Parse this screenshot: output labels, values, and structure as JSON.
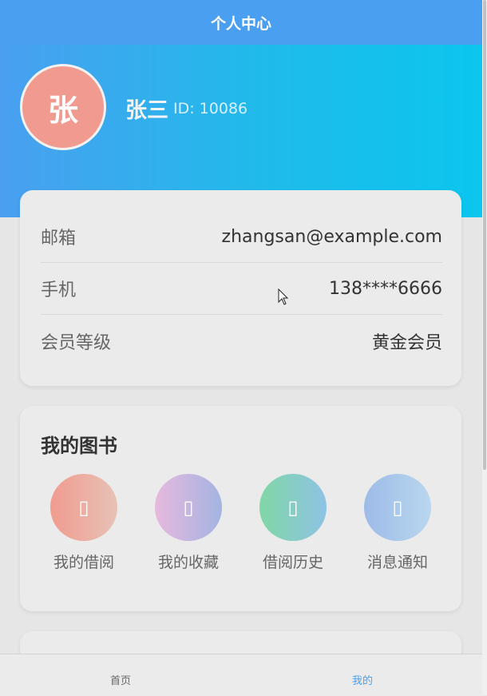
{
  "header": {
    "title": "个人中心"
  },
  "profile": {
    "avatar_char": "张",
    "name": "张三",
    "id_text": "ID: 10086"
  },
  "info": [
    {
      "label": "邮箱",
      "value": "zhangsan@example.com"
    },
    {
      "label": "手机",
      "value": "138****6666"
    },
    {
      "label": "会员等级",
      "value": "黄金会员"
    }
  ],
  "books": {
    "title": "我的图书",
    "items": [
      {
        "label": "我的借阅",
        "icon": "book-icon",
        "glyph": "▯"
      },
      {
        "label": "我的收藏",
        "icon": "heart-icon",
        "glyph": "▯"
      },
      {
        "label": "借阅历史",
        "icon": "history-icon",
        "glyph": "▯"
      },
      {
        "label": "消息通知",
        "icon": "bell-icon",
        "glyph": "▯"
      }
    ]
  },
  "tabbar": {
    "home": "首页",
    "mine": "我的",
    "active_color": "#4a9ff0"
  },
  "colors": {
    "header": "#4a9ff0",
    "hero_end": "#0bc6ee",
    "avatar": "#f19b90"
  }
}
